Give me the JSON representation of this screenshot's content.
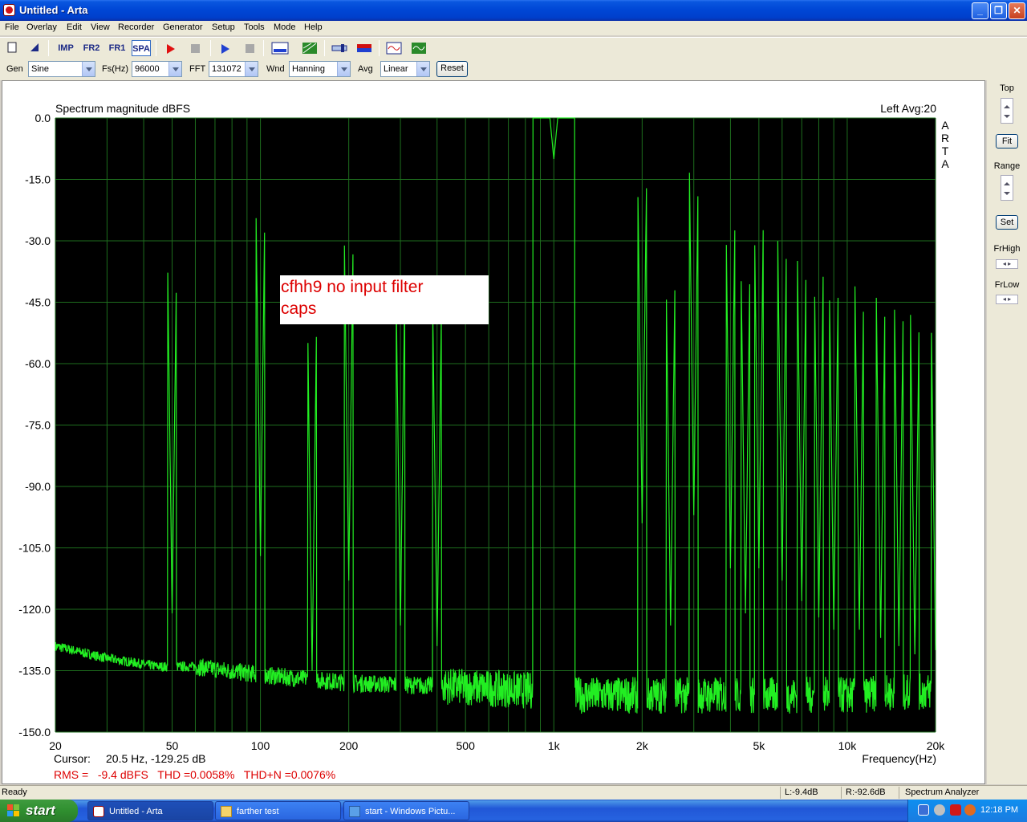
{
  "window": {
    "title": "Untitled - Arta",
    "minimize_glyph": "_",
    "maximize_glyph": "❐",
    "close_glyph": "✕"
  },
  "menu": [
    "File",
    "Overlay",
    "Edit",
    "View",
    "Recorder",
    "Generator",
    "Setup",
    "Tools",
    "Mode",
    "Help"
  ],
  "toolbar": {
    "imp": "IMP",
    "fr2": "FR2",
    "fr1": "FR1",
    "spa": "SPA",
    "icons": [
      "new-icon",
      "open-icon",
      "impulse-mode-icon",
      "fr2-mode-icon",
      "fr1-mode-icon",
      "spa-mode-icon",
      "record-icon",
      "stop-icon",
      "play-icon",
      "stop-icon",
      "abc-icon",
      "grid-icon",
      "meter-icon",
      "color-bar-icon",
      "generator-icon",
      "scope-icon"
    ]
  },
  "controls": {
    "gen_label": "Gen",
    "gen_value": "Sine",
    "fs_label": "Fs(Hz)",
    "fs_value": "96000",
    "fft_label": "FFT",
    "fft_value": "131072",
    "wnd_label": "Wnd",
    "wnd_value": "Hanning",
    "avg_label": "Avg",
    "avg_value": "Linear",
    "reset_label": "Reset"
  },
  "side": {
    "top_label": "Top",
    "fit_label": "Fit",
    "range_label": "Range",
    "set_label": "Set",
    "frhigh_label": "FrHigh",
    "frlow_label": "FrLow",
    "arrows": "◂ ▸"
  },
  "plot": {
    "title": "Spectrum magnitude dBFS",
    "channel_info": "Left  Avg:20",
    "brand_letters": [
      "A",
      "R",
      "T",
      "A"
    ],
    "annotation_line1": "cfhh9 no input filter",
    "annotation_line2": "caps",
    "cursor_label": "Cursor:",
    "cursor_value": "20.5 Hz, -129.25 dB",
    "measure_text": "RMS =   -9.4 dBFS   THD =0.0058%   THD+N =0.0076%",
    "colors": {
      "background": "#000000",
      "grid": "#1e6e1e",
      "trace": "#22ee22",
      "annotation": "#dd0000"
    }
  },
  "chart_data": {
    "type": "line",
    "title": "Spectrum magnitude dBFS",
    "xlabel": "Frequency(Hz)",
    "ylabel": "",
    "x_scale": "log",
    "xlim": [
      20,
      20000
    ],
    "ylim": [
      -150,
      0
    ],
    "x_ticks": [
      20,
      50,
      100,
      200,
      500,
      1000,
      2000,
      5000,
      10000,
      20000
    ],
    "x_tick_labels": [
      "20",
      "50",
      "100",
      "200",
      "500",
      "1k",
      "2k",
      "5k",
      "10k",
      "20k"
    ],
    "y_ticks": [
      0,
      -15,
      -30,
      -45,
      -60,
      -75,
      -90,
      -105,
      -120,
      -135,
      -150
    ],
    "y_tick_labels": [
      "0.0",
      "-15.0",
      "-30.0",
      "-45.0",
      "-60.0",
      "-75.0",
      "-90.0",
      "-105.0",
      "-120.0",
      "-135.0",
      "-150.0"
    ],
    "grid": true,
    "series": [
      {
        "peaks": [
          {
            "x": 50,
            "y": -121
          },
          {
            "x": 100,
            "y": -107
          },
          {
            "x": 150,
            "y": -135
          },
          {
            "x": 200,
            "y": -113
          },
          {
            "x": 300,
            "y": -124
          },
          {
            "x": 400,
            "y": -129
          },
          {
            "x": 1000,
            "y": -10
          },
          {
            "x": 2000,
            "y": -99
          },
          {
            "x": 2500,
            "y": -124
          },
          {
            "x": 3000,
            "y": -97
          },
          {
            "x": 4000,
            "y": -110
          },
          {
            "x": 4500,
            "y": -121
          },
          {
            "x": 5000,
            "y": -110
          },
          {
            "x": 6000,
            "y": -113
          },
          {
            "x": 7000,
            "y": -118
          },
          {
            "x": 8000,
            "y": -122
          },
          {
            "x": 9000,
            "y": -125
          },
          {
            "x": 11000,
            "y": -125
          },
          {
            "x": 13000,
            "y": -127
          },
          {
            "x": 15000,
            "y": -129
          },
          {
            "x": 17000,
            "y": -131
          },
          {
            "x": 20000,
            "y": -130
          }
        ],
        "floor": [
          {
            "x": 20,
            "y": -129
          },
          {
            "x": 30,
            "y": -132
          },
          {
            "x": 45,
            "y": -134
          },
          {
            "x": 60,
            "y": -134
          },
          {
            "x": 100,
            "y": -136
          },
          {
            "x": 200,
            "y": -138
          },
          {
            "x": 500,
            "y": -139
          },
          {
            "x": 900,
            "y": -140
          },
          {
            "x": 1200,
            "y": -141
          },
          {
            "x": 3000,
            "y": -141
          },
          {
            "x": 10000,
            "y": -141
          },
          {
            "x": 20000,
            "y": -140
          }
        ]
      }
    ]
  },
  "status": {
    "ready": "Ready",
    "left_level": "L:-9.4dB",
    "right_level": "R:-92.6dB",
    "mode": "Spectrum Analyzer"
  },
  "taskbar": {
    "start": "start",
    "tasks": [
      "Untitled - Arta",
      "farther test",
      "start - Windows Pictu..."
    ],
    "clock": "12:18 PM"
  }
}
